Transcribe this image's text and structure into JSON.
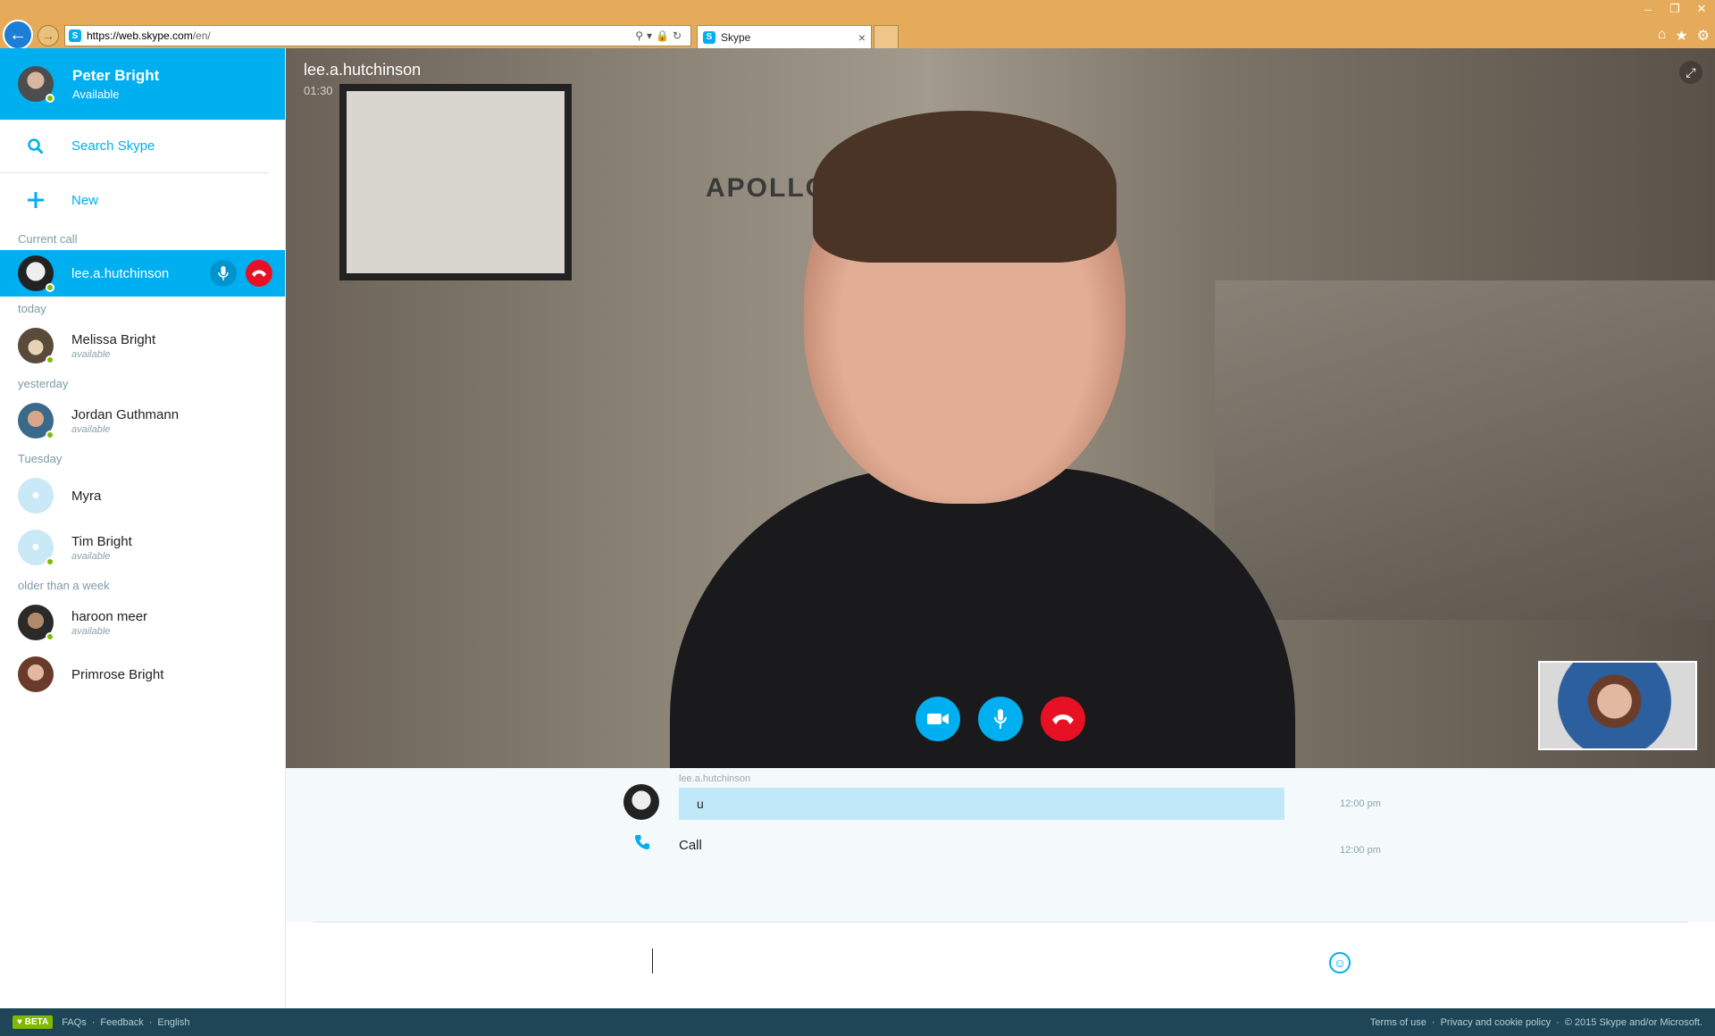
{
  "browser": {
    "url_host": "https://web.skype.com",
    "url_path": "/en/",
    "tab_title": "Skype",
    "favicon_label": "S"
  },
  "profile": {
    "name": "Peter Bright",
    "status": "Available"
  },
  "sidebar": {
    "search_label": "Search Skype",
    "new_label": "New",
    "current_call_label": "Current call",
    "current_call_name": "lee.a.hutchinson",
    "groups": {
      "today": "today",
      "yesterday": "yesterday",
      "tuesday": "Tuesday",
      "older": "older than a week"
    },
    "contacts": {
      "melissa": {
        "name": "Melissa Bright",
        "status": "available"
      },
      "jordan": {
        "name": "Jordan Guthmann",
        "status": "available"
      },
      "myra": {
        "name": "Myra"
      },
      "tim": {
        "name": "Tim Bright",
        "status": "available"
      },
      "haroon": {
        "name": "haroon meer",
        "status": "available"
      },
      "primrose": {
        "name": "Primrose Bright"
      }
    }
  },
  "call": {
    "participant": "lee.a.hutchinson",
    "duration": "01:30",
    "poster_text": "APOLLO"
  },
  "conversation": {
    "messages": [
      {
        "author": "lee.a.hutchinson",
        "text": "u",
        "time": "12:00 pm"
      }
    ],
    "call_event": {
      "label": "Call",
      "time": "12:00 pm"
    }
  },
  "composer": {
    "value": ""
  },
  "footer": {
    "beta": "♥ BETA",
    "faqs": "FAQs",
    "feedback": "Feedback",
    "language": "English",
    "terms": "Terms of use",
    "privacy": "Privacy and cookie policy",
    "copyright": "© 2015 Skype and/or Microsoft."
  },
  "colors": {
    "accent": "#00aff0",
    "end_call": "#e81123",
    "online": "#7fba00",
    "footer_bg": "#1f4656"
  },
  "icons": {
    "back": "arrow-left-icon",
    "forward": "arrow-right-icon",
    "search": "search-icon",
    "new": "plus-icon",
    "mic": "microphone-icon",
    "hangup": "phone-hangup-icon",
    "video": "video-camera-icon",
    "expand": "expand-icon",
    "phone": "phone-icon",
    "emoji": "smiley-icon"
  }
}
